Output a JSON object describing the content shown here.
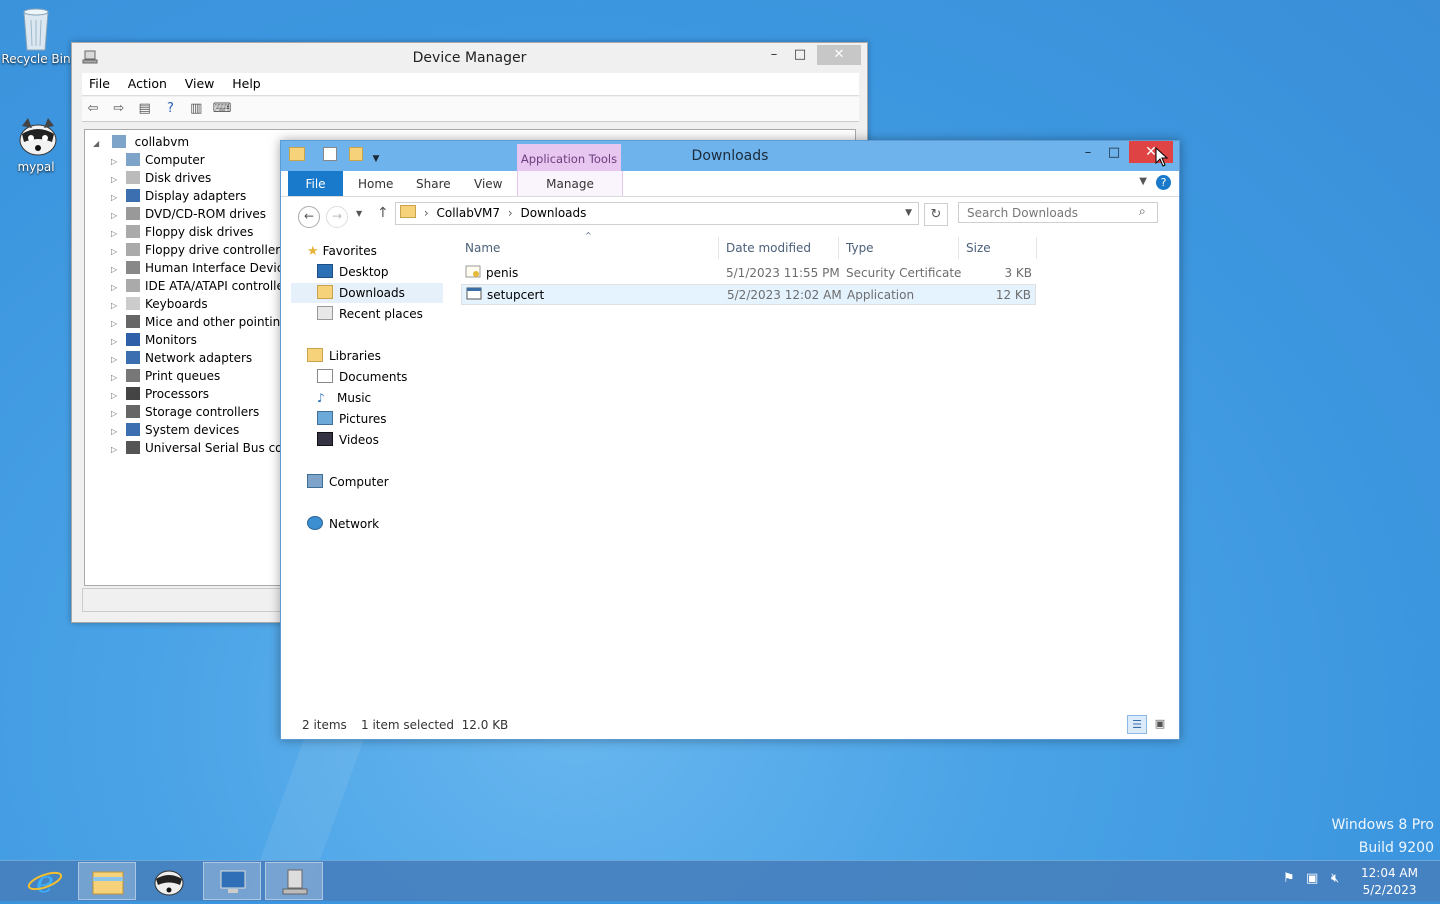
{
  "desktop": {
    "icons": [
      {
        "label": "Recycle Bin"
      },
      {
        "label": "mypal"
      }
    ],
    "watermark": {
      "line1": "Windows 8 Pro",
      "line2": "Build 9200"
    }
  },
  "device_manager": {
    "title": "Device Manager",
    "menu": [
      "File",
      "Action",
      "View",
      "Help"
    ],
    "window_buttons": {
      "minimize": "–",
      "maximize": "□",
      "close": "✕"
    },
    "tree": {
      "root": "collabvm",
      "items": [
        "Computer",
        "Disk drives",
        "Display adapters",
        "DVD/CD-ROM drives",
        "Floppy disk drives",
        "Floppy drive controllers",
        "Human Interface Devices",
        "IDE ATA/ATAPI controllers",
        "Keyboards",
        "Mice and other pointing devices",
        "Monitors",
        "Network adapters",
        "Print queues",
        "Processors",
        "Storage controllers",
        "System devices",
        "Universal Serial Bus controllers"
      ]
    }
  },
  "explorer": {
    "title": "Downloads",
    "contextual_tab_group": "Application Tools",
    "ribbon_tabs": {
      "file": "File",
      "home": "Home",
      "share": "Share",
      "view": "View",
      "manage": "Manage"
    },
    "window_buttons": {
      "minimize": "–",
      "maximize": "□",
      "close": "✕"
    },
    "address": {
      "segments": [
        "CollabVM7",
        "Downloads"
      ],
      "separator": "›"
    },
    "search": {
      "placeholder": "Search Downloads"
    },
    "nav": {
      "favorites": {
        "label": "Favorites",
        "items": [
          "Desktop",
          "Downloads",
          "Recent places"
        ]
      },
      "libraries": {
        "label": "Libraries",
        "items": [
          "Documents",
          "Music",
          "Pictures",
          "Videos"
        ]
      },
      "computer": "Computer",
      "network": "Network"
    },
    "columns": {
      "name": "Name",
      "date": "Date modified",
      "type": "Type",
      "size": "Size"
    },
    "files": [
      {
        "name": "penis",
        "date": "5/1/2023 11:55 PM",
        "type": "Security Certificate",
        "size": "3 KB",
        "icon": "certificate-icon"
      },
      {
        "name": "setupcert",
        "date": "5/2/2023 12:02 AM",
        "type": "Application",
        "size": "12 KB",
        "icon": "application-icon"
      }
    ],
    "status": {
      "count": "2 items",
      "selection": "1 item selected  12.0 KB"
    }
  },
  "taskbar": {
    "clock": {
      "time": "12:04 AM",
      "date": "5/2/2023"
    },
    "buttons": [
      "internet-explorer-icon",
      "file-explorer-icon",
      "mypal-icon",
      "remote-desktop-icon",
      "device-manager-icon"
    ]
  },
  "colors": {
    "accent": "#1979ca",
    "close_red": "#e04343",
    "app_tools": "#e7c6f0"
  }
}
